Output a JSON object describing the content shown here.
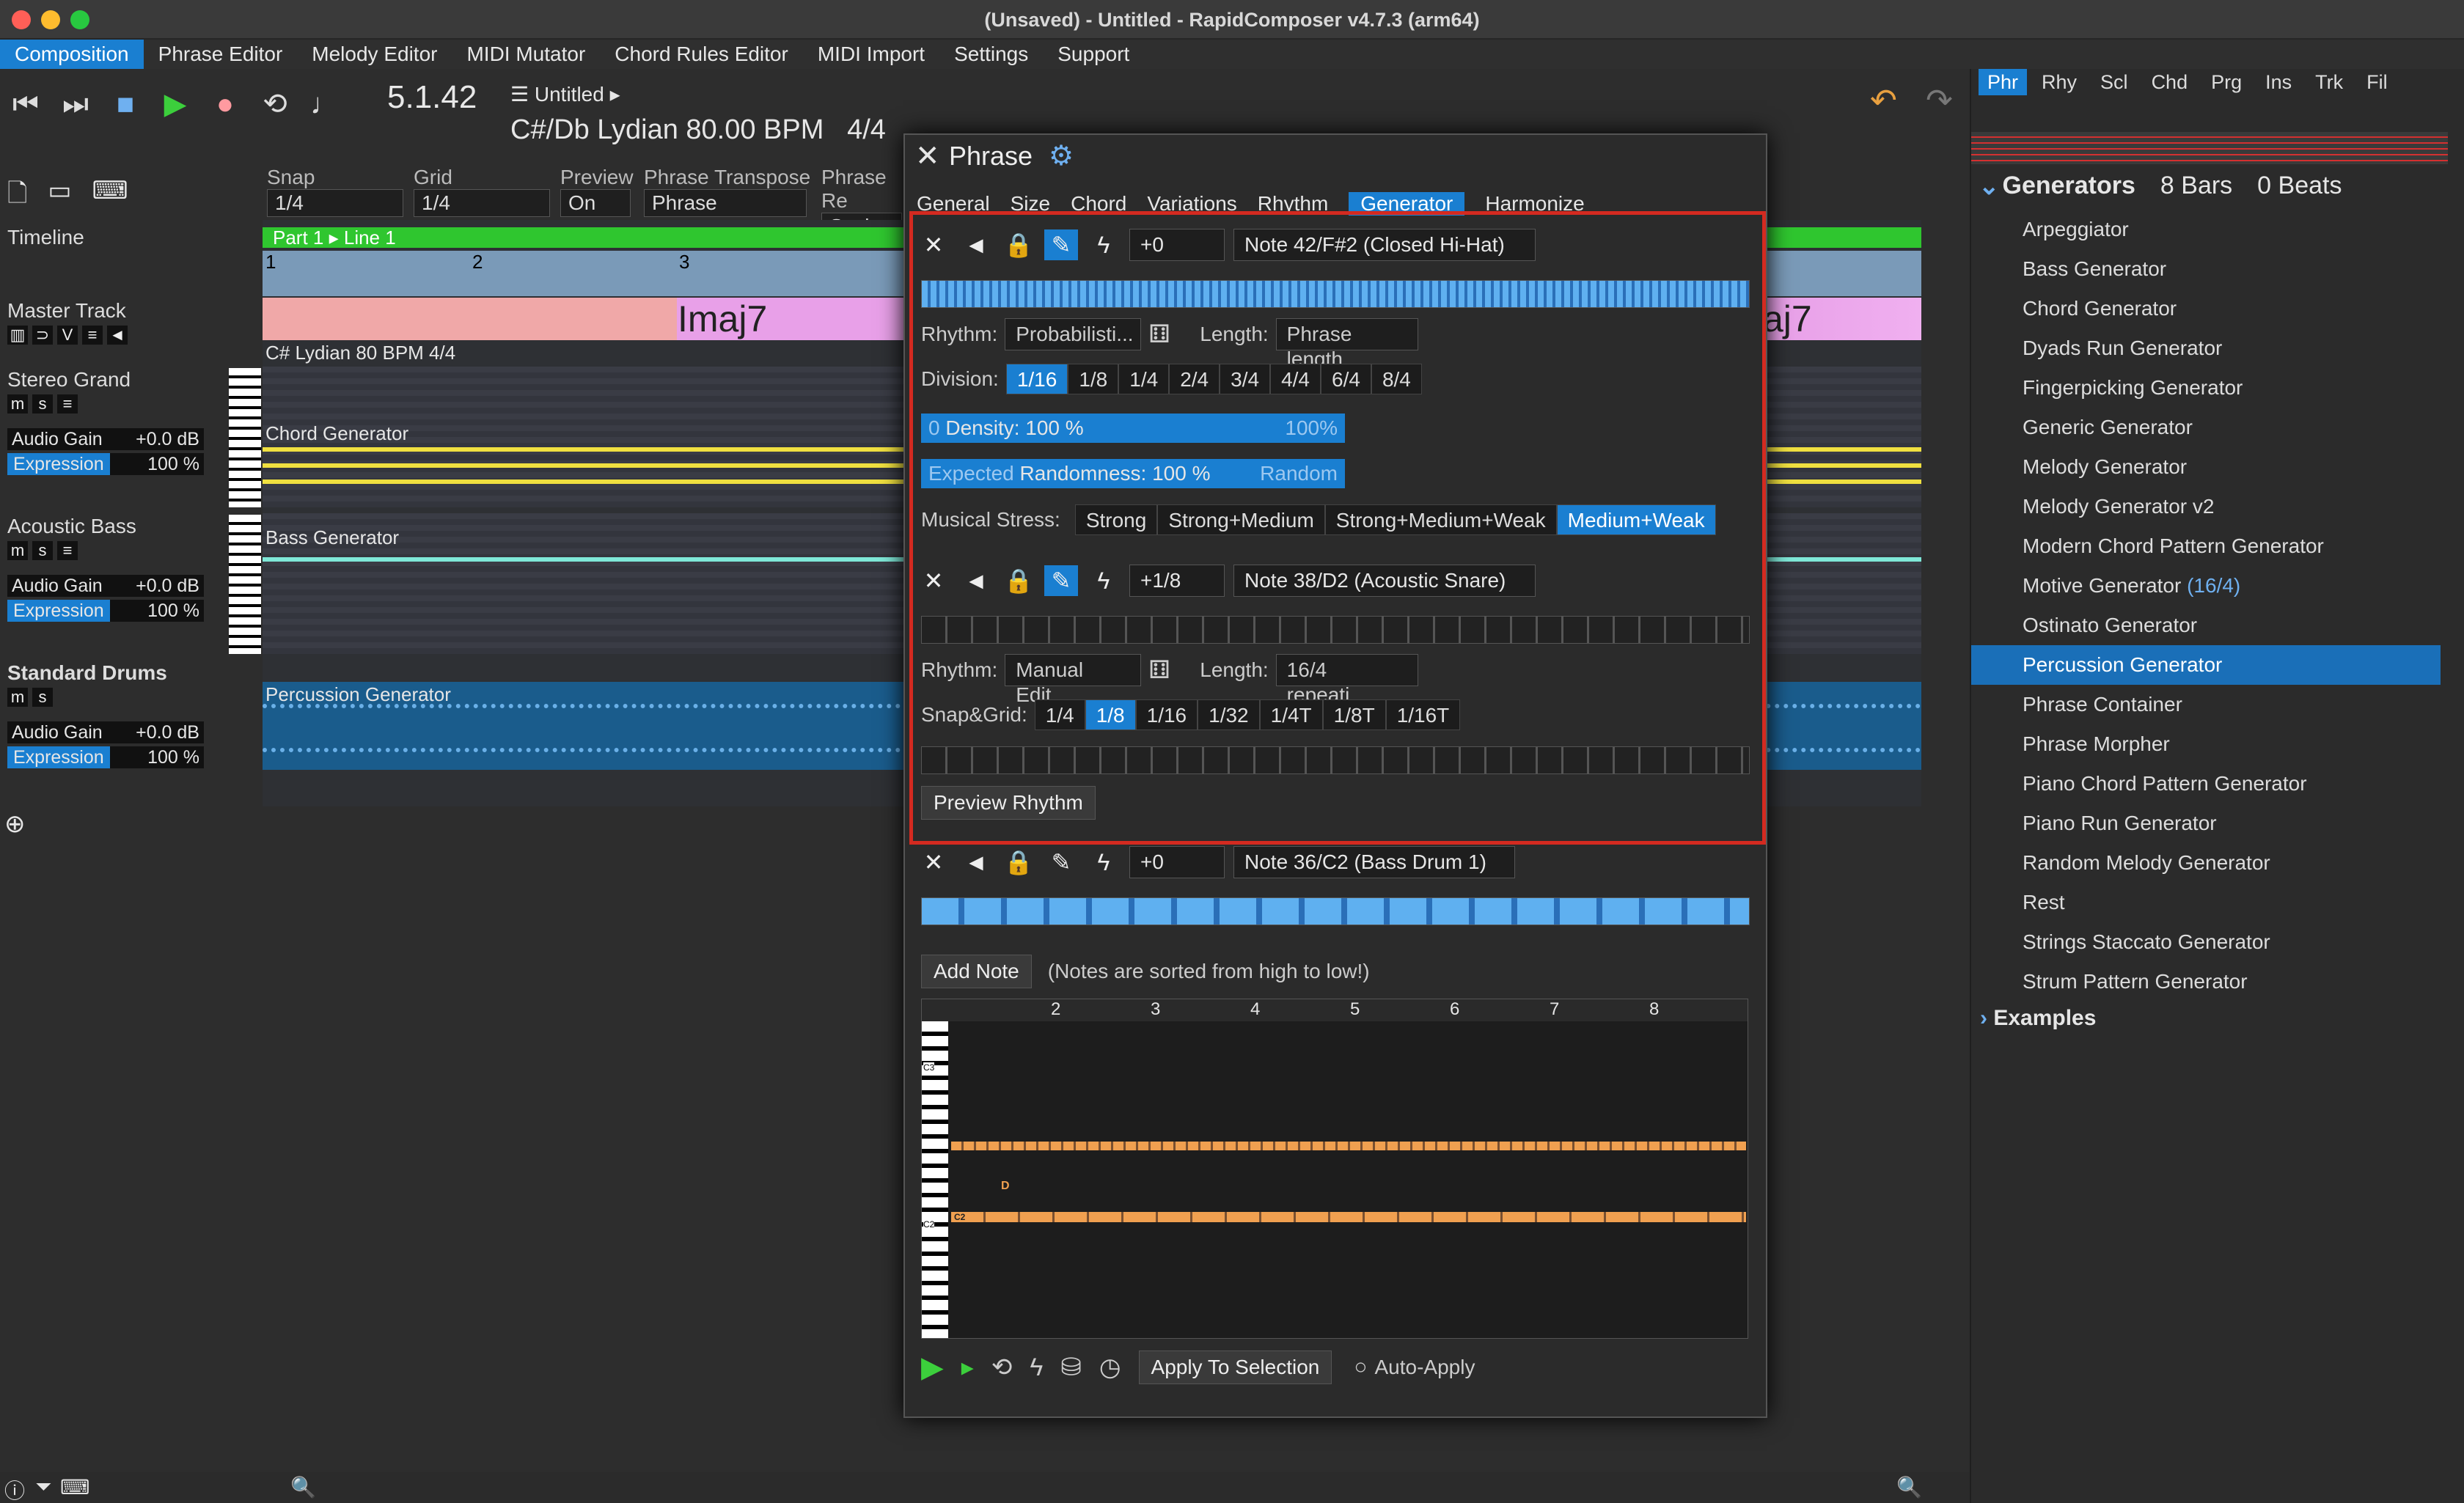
{
  "window": {
    "title": "(Unsaved) - Untitled - RapidComposer v4.7.3 (arm64)"
  },
  "menu": [
    "Composition",
    "Phrase Editor",
    "Melody Editor",
    "MIDI Mutator",
    "Chord Rules Editor",
    "MIDI Import",
    "Settings",
    "Support"
  ],
  "transport": {
    "position": "5.1.42",
    "song": "Untitled",
    "key_tempo": "C#/Db Lydian  80.00 BPM",
    "meter": "4/4"
  },
  "controls": [
    {
      "label": "Snap",
      "value": "1/4"
    },
    {
      "label": "Grid",
      "value": "1/4"
    },
    {
      "label": "Preview",
      "value": "On"
    },
    {
      "label": "Phrase Transpose",
      "value": "Phrase"
    },
    {
      "label": "Phrase Re",
      "value": "Scale"
    }
  ],
  "timeline": {
    "label": "Timeline",
    "part": "Part 1 ▸ Line 1",
    "bars": [
      "1",
      "2",
      "3"
    ],
    "chord": "Imaj7",
    "chord_right": "aj7",
    "info": "C# Lydian 80 BPM 4/4"
  },
  "tracks": [
    {
      "name": "Master Track"
    },
    {
      "name": "Stereo Grand",
      "gain": "+0.0 dB",
      "expr": "100 %",
      "phrase": "Chord Generator"
    },
    {
      "name": "Acoustic Bass",
      "gain": "+0.0 dB",
      "expr": "100 %",
      "phrase": "Bass Generator"
    },
    {
      "name": "Standard Drums",
      "gain": "+0.0 dB",
      "expr": "100 %",
      "phrase": "Percussion Generator"
    }
  ],
  "track_labels": {
    "gain": "Audio Gain",
    "expr": "Expression"
  },
  "dialog": {
    "title": "Phrase",
    "tabs": [
      "General",
      "Size",
      "Chord",
      "Variations",
      "Rhythm",
      "Generator",
      "Harmonize"
    ],
    "note1": {
      "offset": "+0",
      "note": "Note 42/F#2 (Closed Hi-Hat)",
      "rhythm_label": "Rhythm:",
      "rhythm": "Probabilisti...",
      "length_label": "Length:",
      "length": "Phrase length"
    },
    "division": {
      "label": "Division:",
      "options": [
        "1/16",
        "1/8",
        "1/4",
        "2/4",
        "3/4",
        "4/4",
        "6/4",
        "8/4"
      ],
      "selected": "1/16"
    },
    "density": {
      "left": "0",
      "label": "Density: 100 %",
      "right": "100%"
    },
    "randomness": {
      "left": "Expected",
      "label": "Randomness: 100 %",
      "right": "Random"
    },
    "stress": {
      "label": "Musical Stress:",
      "options": [
        "Strong",
        "Strong+Medium",
        "Strong+Medium+Weak",
        "Medium+Weak"
      ],
      "selected": "Medium+Weak"
    },
    "note2": {
      "offset": "+1/8",
      "note": "Note 38/D2 (Acoustic Snare)",
      "rhythm": "Manual Edit...",
      "length": "16/4 repeati..."
    },
    "snap": {
      "label": "Snap&Grid:",
      "options": [
        "1/4",
        "1/8",
        "1/16",
        "1/32",
        "1/4T",
        "1/8T",
        "1/16T"
      ],
      "selected": "1/8"
    },
    "preview_rhythm": "Preview Rhythm",
    "note3": {
      "offset": "+0",
      "note": "Note 36/C2 (Bass Drum 1)"
    },
    "add_note": "Add Note",
    "sorted_hint": "(Notes are sorted from high to low!)",
    "roll_bars": [
      "2",
      "3",
      "4",
      "5",
      "6",
      "7",
      "8"
    ],
    "roll_keys": [
      "C3",
      "C2"
    ],
    "roll_note_labels": [
      "C2",
      "D"
    ],
    "apply": "Apply To Selection",
    "auto_apply": "Auto-Apply"
  },
  "right_panel": {
    "tabs": [
      "Phr",
      "Rhy",
      "Scl",
      "Chd",
      "Prg",
      "Ins",
      "Trk",
      "Fil"
    ],
    "header": {
      "title": "Generators",
      "bars": "8 Bars",
      "beats": "0 Beats"
    },
    "items": [
      "Arpeggiator",
      "Bass Generator",
      "Chord Generator",
      "Dyads Run Generator",
      "Fingerpicking Generator",
      "Generic Generator",
      "Melody Generator",
      "Melody Generator v2",
      "Modern Chord Pattern Generator",
      "Motive Generator",
      "Ostinato Generator",
      "Percussion Generator",
      "Phrase Container",
      "Phrase Morpher",
      "Piano Chord Pattern Generator",
      "Piano Run Generator",
      "Random Melody Generator",
      "Rest",
      "Strings Staccato Generator",
      "Strum Pattern Generator"
    ],
    "motive_count": "(16/4)",
    "selected": "Percussion Generator",
    "examples": "Examples"
  },
  "colors": {
    "accent": "#1a7fd1",
    "highlight": "#d42a20",
    "yellow": "#f0e040",
    "cyan": "#7fe8d8",
    "orange": "#f0a050"
  }
}
